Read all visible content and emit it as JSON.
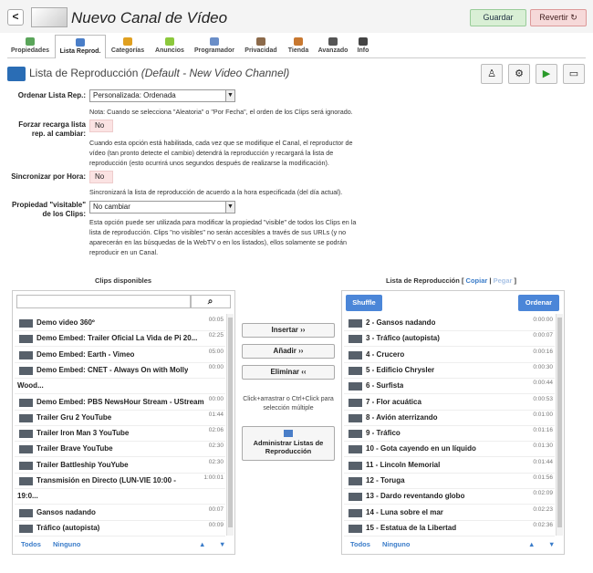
{
  "header": {
    "title": "Nuevo Canal de Vídeo",
    "back_label": "<",
    "save_label": "Guardar",
    "revert_label": "Revertir ↻"
  },
  "tabs": [
    {
      "label": "Propiedades",
      "color": "#5aa55a"
    },
    {
      "label": "Lista Reprod.",
      "color": "#4a7ec8"
    },
    {
      "label": "Categorías",
      "color": "#e0a020"
    },
    {
      "label": "Anuncios",
      "color": "#8cc83c"
    },
    {
      "label": "Programador",
      "color": "#6a8ec8"
    },
    {
      "label": "Privacidad",
      "color": "#8c6a4a"
    },
    {
      "label": "Tienda",
      "color": "#c87830"
    },
    {
      "label": "Avanzado",
      "color": "#555"
    },
    {
      "label": "Info",
      "color": "#444"
    }
  ],
  "section": {
    "title": "Lista de Reproducción",
    "subtitle": "(Default - New Video Channel)",
    "icons": [
      "user-chart-icon",
      "settings-user-icon",
      "play-icon",
      "monitor-icon"
    ]
  },
  "settings": {
    "order_label": "Ordenar Lista Rep.:",
    "order_value": "Personalizada: Ordenada",
    "order_note": "Nota: Cuando se selecciona \"Aleatoria\" o \"Por Fecha\", el orden de los Clips será ignorado.",
    "reload_label": "Forzar recarga lista rep. al cambiar:",
    "reload_value": "No",
    "reload_note": "Cuando esta opción está habilitada, cada vez que se modifique el Canal, el reproductor de vídeo (tan pronto detecte el cambio) detendrá la reproducción y recargará la lista de reproducción (esto ocurrirá unos segundos después de realizarse la modificación).",
    "sync_label": "Sincronizar por Hora:",
    "sync_value": "No",
    "sync_note": "Sincronizará la lista de reproducción de acuerdo a la hora especificada (del día actual).",
    "visible_label": "Propiedad \"visitable\" de los Clips:",
    "visible_value": "No cambiar",
    "visible_note": "Esta opción puede ser utilizada para modificar la propiedad \"visible\" de todos los Clips en la lista de reproducción. Clips \"no visibles\" no serán accesibles a través de sus URLs (y no aparecerán en las búsquedas de la WebTV o en los listados), ellos solamente se podrán reproducir en un Canal."
  },
  "available": {
    "title": "Clips disponibles",
    "search_placeholder": "",
    "items": [
      {
        "title": "Demo video 360º",
        "dur": "00:05"
      },
      {
        "title": "Demo Embed: Trailer Oficial La Vida de Pi 20...",
        "dur": "02:25"
      },
      {
        "title": "Demo Embed: Earth - Vimeo",
        "dur": "05:00"
      },
      {
        "title": "Demo Embed: CNET - Always On with Molly",
        "dur": "00:00"
      },
      {
        "title": "Wood...",
        "dur": ""
      },
      {
        "title": "Demo Embed: PBS NewsHour Stream - UStream",
        "dur": "00:00"
      },
      {
        "title": "Trailer Gru 2 YouTube",
        "dur": "01:44"
      },
      {
        "title": "Trailer Iron Man 3 YouTube",
        "dur": "02:06"
      },
      {
        "title": "Trailer Brave YouTube",
        "dur": "02:30"
      },
      {
        "title": "Trailer Battleship YouYube",
        "dur": "02:30"
      },
      {
        "title": "Transmisión en Directo (LUN-VIE 10:00 -",
        "dur": "1:00:01"
      },
      {
        "title": "19:0...",
        "dur": ""
      },
      {
        "title": "Gansos nadando",
        "dur": "00:07"
      },
      {
        "title": "Tráfico (autopista)",
        "dur": "00:09"
      }
    ],
    "all": "Todos",
    "none": "Ninguno"
  },
  "middle": {
    "insert": "Insertar ››",
    "add": "Añadir ››",
    "remove": "Eliminar ‹‹",
    "hint": "Click+arrastrar o Ctrl+Click para selección múltiple",
    "manage": "Administrar Listas de Reproducción"
  },
  "playlist": {
    "title": "Lista de Reproducción",
    "copy": "Copiar",
    "paste": "Pegar",
    "shuffle": "Shuffle",
    "order": "Ordenar",
    "items": [
      {
        "title": "2 - Gansos nadando",
        "dur": "0:00:00"
      },
      {
        "title": "3 - Tráfico (autopista)",
        "dur": "0:00:07"
      },
      {
        "title": "4 - Crucero",
        "dur": "0:00:16"
      },
      {
        "title": "5 - Edificio Chrysler",
        "dur": "0:00:30"
      },
      {
        "title": "6 - Surfista",
        "dur": "0:00:44"
      },
      {
        "title": "7 - Flor acuática",
        "dur": "0:00:53"
      },
      {
        "title": "8 - Avión aterrizando",
        "dur": "0:01:00"
      },
      {
        "title": "9 - Tráfico",
        "dur": "0:01:16"
      },
      {
        "title": "10 - Gota cayendo en un líquido",
        "dur": "0:01:30"
      },
      {
        "title": "11 - Lincoln Memorial",
        "dur": "0:01:44"
      },
      {
        "title": "12 - Toruga",
        "dur": "0:01:56"
      },
      {
        "title": "13 - Dardo reventando globo",
        "dur": "0:02:09"
      },
      {
        "title": "14 - Luna sobre el mar",
        "dur": "0:02:23"
      },
      {
        "title": "15 - Estatua de la Libertad",
        "dur": "0:02:36"
      }
    ],
    "all": "Todos",
    "none": "Ninguno"
  }
}
